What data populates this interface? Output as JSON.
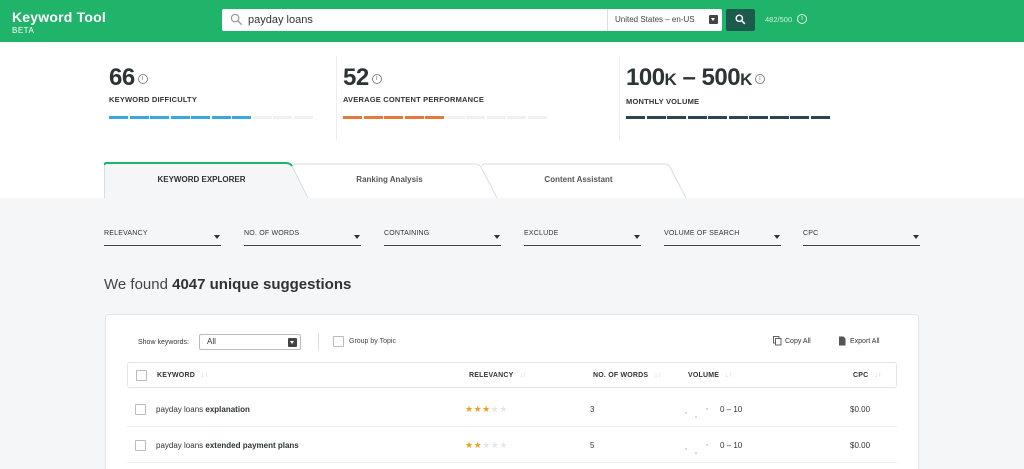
{
  "app": {
    "name": "Keyword Tool",
    "badge": "BETA"
  },
  "search": {
    "query": "payday loans",
    "country": "United States – en-US",
    "quota": "482/500"
  },
  "metrics": [
    {
      "value": "66",
      "label": "KEYWORD DIFFICULTY",
      "level": 0.65,
      "color": "#3aa7e1"
    },
    {
      "value": "52",
      "label": "AVERAGE CONTENT PERFORMANCE",
      "level": 0.52,
      "color": "#e67a3c"
    },
    {
      "value_low": "100",
      "unit_low": "K",
      "dash": " – ",
      "value_high": "500",
      "unit_high": "K",
      "label": "MONTHLY VOLUME",
      "level": 1.0,
      "color": "#2d4454"
    }
  ],
  "tabs": [
    "KEYWORD EXPLORER",
    "Ranking Analysis",
    "Content Assistant"
  ],
  "filters": [
    "RELEVANCY",
    "NO. OF WORDS",
    "CONTAINING",
    "EXCLUDE",
    "VOLUME OF SEARCH",
    "CPC"
  ],
  "results": {
    "prefix": "We found",
    "count_text": "4047 unique suggestions"
  },
  "toolbar": {
    "show_label": "Show keywords:",
    "show_value": "All",
    "group_label": "Group by Topic",
    "copy_label": "Copy All",
    "export_label": "Export All"
  },
  "table": {
    "columns": [
      "KEYWORD",
      "RELEVANCY",
      "NO. OF WORDS",
      "VOLUME",
      "CPC"
    ],
    "sort_glyph": "↓↑",
    "rows": [
      {
        "base": "payday loans",
        "suffix": "explanation",
        "relevancy": 3,
        "words": "3",
        "volume": "0 – 10",
        "cpc": "$0.00"
      },
      {
        "base": "payday loans",
        "suffix": "extended payment plans",
        "relevancy": 2,
        "words": "5",
        "volume": "0 – 10",
        "cpc": "$0.00"
      }
    ]
  },
  "colors": {
    "brand": "#1fb46a",
    "accent_dark": "#1c5a4b",
    "star": "#f0a020"
  }
}
